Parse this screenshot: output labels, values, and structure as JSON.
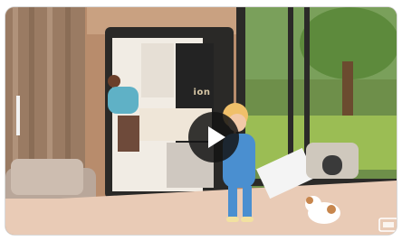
{
  "video": {
    "sign_text": "ion",
    "play_icon": "play-icon",
    "expand_icon": "expand-icon"
  },
  "colors": {
    "play_button": "#1a1a1a",
    "wall_wood": "#c79d7b",
    "floor": "#e8c6b2",
    "lawn": "#8fae4a"
  }
}
